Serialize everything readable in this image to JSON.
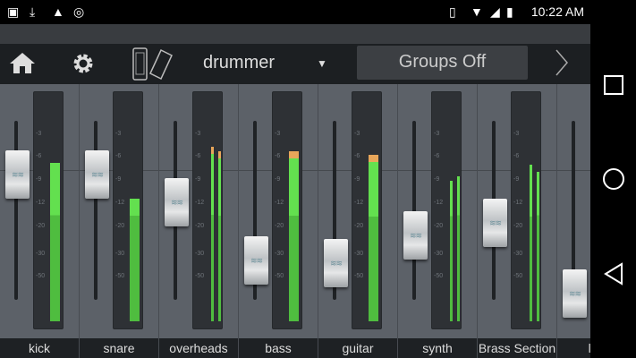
{
  "status_bar": {
    "time": "10:22 AM",
    "icons": [
      "gallery-icon",
      "download-icon",
      "warning-icon",
      "sync-icon",
      "vibrate-icon",
      "wifi-icon",
      "signal-icon",
      "battery-icon"
    ]
  },
  "toolbar": {
    "mix_name": "drummer",
    "groups_button": "Groups Off"
  },
  "colors": {
    "meter_green": "#63e04f",
    "meter_peak": "#e8a65a",
    "strip_bg": "#5c6168"
  },
  "meter_scale": [
    "-3",
    "-6",
    "-9",
    "-12",
    "-20",
    "-30",
    "-50"
  ],
  "channels": [
    {
      "name": "kick",
      "fader": 0.7,
      "meter": [
        0.7
      ],
      "peak": false
    },
    {
      "name": "snare",
      "fader": 0.7,
      "meter": [
        0.54
      ],
      "peak": false
    },
    {
      "name": "overheads",
      "fader": 0.545,
      "meter": [
        0.77,
        0.75
      ],
      "peak": true
    },
    {
      "name": "bass",
      "fader": 0.22,
      "meter": [
        0.75
      ],
      "peak": true
    },
    {
      "name": "guitar",
      "fader": 0.205,
      "meter": [
        0.735
      ],
      "peak": true
    },
    {
      "name": "synth",
      "fader": 0.36,
      "meter": [
        0.62,
        0.64
      ],
      "peak": false
    },
    {
      "name": "Brass Section",
      "fader": 0.43,
      "meter": [
        0.69,
        0.66
      ],
      "peak": false
    },
    {
      "name": "lea",
      "fader": 0.035,
      "meter": [],
      "peak": false
    }
  ]
}
